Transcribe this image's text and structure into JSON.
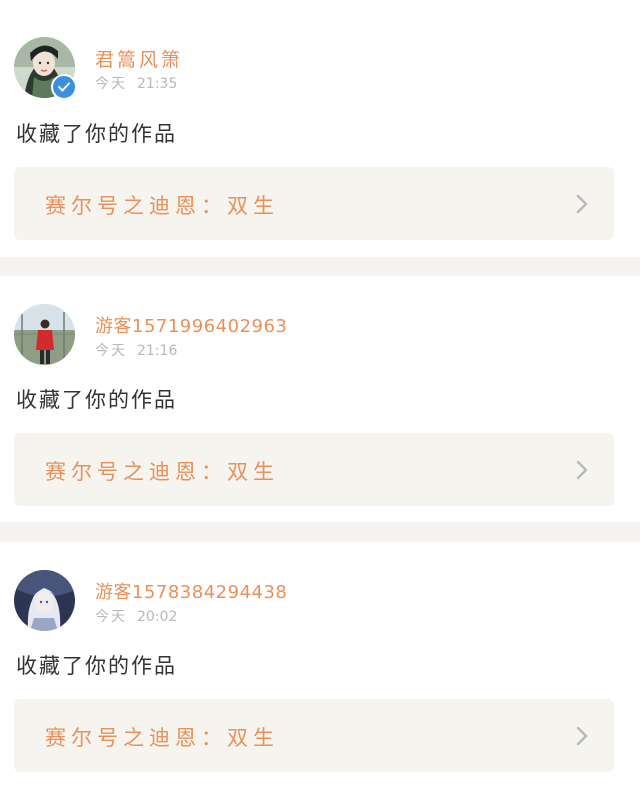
{
  "notifications": [
    {
      "username": "君篙风箫",
      "time_day": "今天",
      "time_clock": "21:35",
      "verified": true,
      "action_text": "收藏了你的作品",
      "work_title": "赛尔号之迪恩：双生"
    },
    {
      "username": "游客1571996402963",
      "time_day": "今天",
      "time_clock": "21:16",
      "verified": false,
      "action_text": "收藏了你的作品",
      "work_title": "赛尔号之迪恩：双生"
    },
    {
      "username": "游客1578384294438",
      "time_day": "今天",
      "time_clock": "20:02",
      "verified": false,
      "action_text": "收藏了你的作品",
      "work_title": "赛尔号之迪恩：双生"
    }
  ],
  "colors": {
    "accent": "#e8915a",
    "tab_indicator": "#f07aa2",
    "verified_badge": "#3a8fe0",
    "link_background": "#f5f4ef",
    "page_background": "#f5f4f2"
  },
  "icons": {
    "verified": "check-badge-icon",
    "chevron": "chevron-right-icon"
  }
}
